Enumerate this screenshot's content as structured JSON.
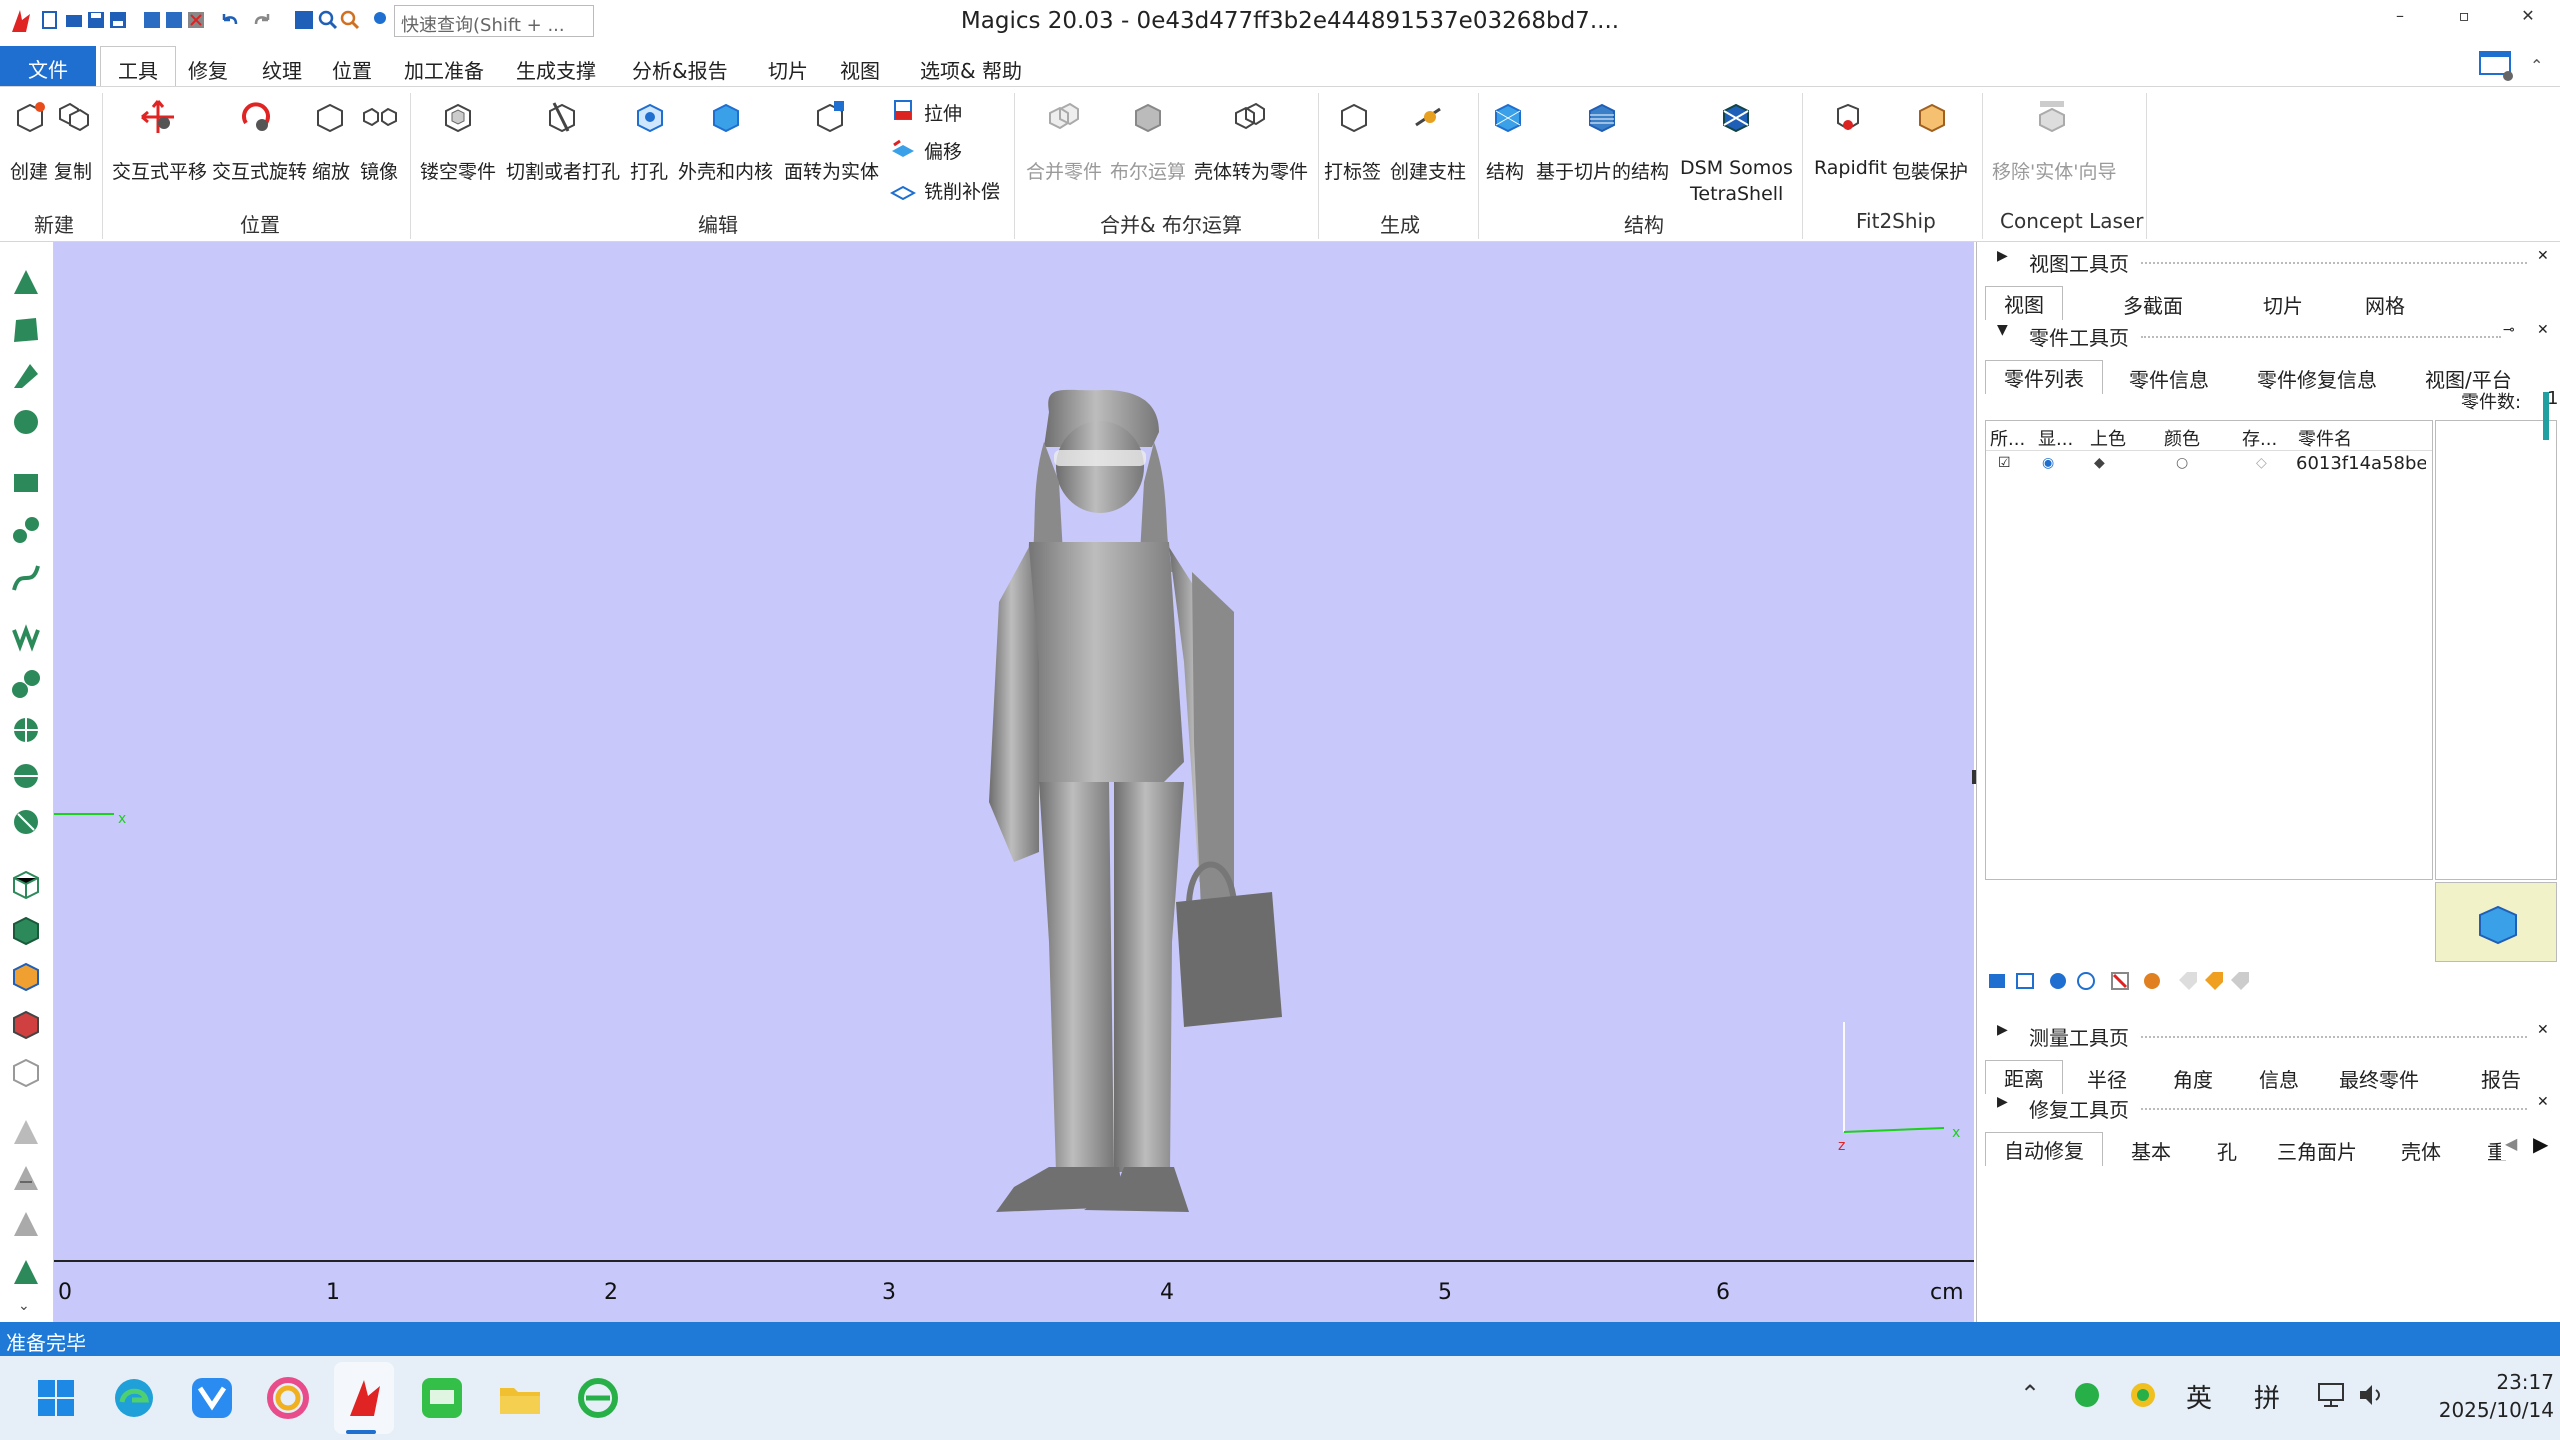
{
  "window": {
    "title": "Magics 20.03 - 0e43d477ff3b2e444891537e03268bd7....",
    "search_placeholder": "快速查询(Shift + ..."
  },
  "menu": {
    "file": "文件",
    "items": [
      "工具",
      "修复",
      "纹理",
      "位置",
      "加工准备",
      "生成支撑",
      "分析&报告",
      "切片",
      "视图",
      "选项& 帮助"
    ]
  },
  "ribbon": {
    "groups": {
      "new": "新建",
      "position": "位置",
      "edit": "编辑",
      "merge": "合并& 布尔运算",
      "generate": "生成",
      "structure": "结构",
      "fit2ship": "Fit2Ship",
      "concept": "Concept Laser"
    },
    "buttons": {
      "create": "创建",
      "copy": "复制",
      "translate": "交互式平移",
      "rotate": "交互式旋转",
      "scale": "缩放",
      "mirror": "镜像",
      "hollow": "镂空零件",
      "cut": "切割或者打孔",
      "punch": "打孔",
      "shell": "外壳和内核",
      "face_to_solid": "面转为实体",
      "extrude": "拉伸",
      "offset": "偏移",
      "mill": "铣削补偿",
      "merge": "合并零件",
      "boolean": "布尔运算",
      "shell_to_part": "壳体转为零件",
      "label": "打标签",
      "pillar": "创建支柱",
      "struct": "结构",
      "slice_struct": "基于切片的结构",
      "dsm": "DSM Somos",
      "dsm2": "TetraShell",
      "rapidfit": "Rapidfit",
      "wrap": "包裝保护",
      "remove_wizard": "移除'实体'向导"
    }
  },
  "viewport": {
    "ruler_labels": [
      "0",
      "1",
      "2",
      "3",
      "4",
      "5",
      "6"
    ],
    "ruler_unit": "cm",
    "axes": {
      "x": "x",
      "z": "z"
    }
  },
  "right_panel": {
    "view_page": {
      "title": "视图工具页",
      "tabs": [
        "视图",
        "多截面",
        "切片",
        "网格"
      ]
    },
    "parts_page": {
      "title": "零件工具页",
      "tabs": [
        "零件列表",
        "零件信息",
        "零件修复信息",
        "视图/平台"
      ],
      "count_label": "零件数:",
      "count": "1",
      "columns": [
        "所...",
        "显...",
        "上色",
        "颜色",
        "存...",
        "零件名"
      ],
      "rows": [
        {
          "name": "6013f14a58be"
        }
      ]
    },
    "measure_page": {
      "title": "测量工具页",
      "tabs": [
        "距离",
        "半径",
        "角度",
        "信息",
        "最终零件",
        "报告"
      ]
    },
    "repair_page": {
      "title": "修复工具页",
      "tabs": [
        "自动修复",
        "基本",
        "孔",
        "三角面片",
        "壳体",
        "重"
      ]
    }
  },
  "status": {
    "text": "准备完毕"
  },
  "taskbar": {
    "ime_lang": "英",
    "ime_mode": "拼",
    "time": "23:17",
    "date": "2025/10/14"
  },
  "colors": {
    "viewport": "#c8c8fa",
    "accent": "#1f6fd1",
    "status": "#1e7ad6"
  }
}
